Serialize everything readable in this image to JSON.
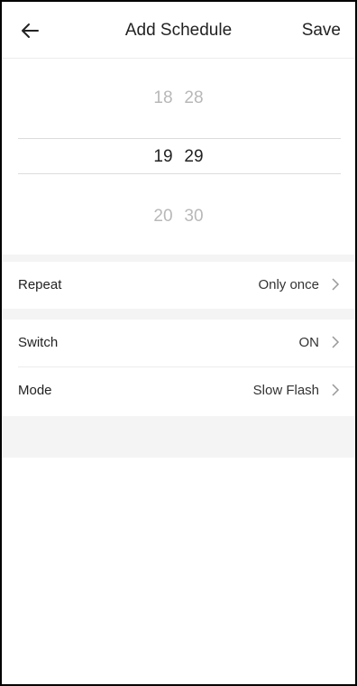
{
  "header": {
    "title": "Add Schedule",
    "save_label": "Save"
  },
  "picker": {
    "above": {
      "hour": "18",
      "minute": "28"
    },
    "selected": {
      "hour": "19",
      "minute": "29"
    },
    "below": {
      "hour": "20",
      "minute": "30"
    }
  },
  "settings": [
    {
      "label": "Repeat",
      "value": "Only once"
    },
    {
      "label": "Switch",
      "value": "ON"
    },
    {
      "label": "Mode",
      "value": "Slow Flash"
    }
  ],
  "icons": {
    "back": "arrow-left-icon",
    "chevron": "chevron-right-icon"
  },
  "colors": {
    "text": "#222222",
    "faded_text": "#b8b8b8",
    "section_gap": "#f4f4f4"
  }
}
